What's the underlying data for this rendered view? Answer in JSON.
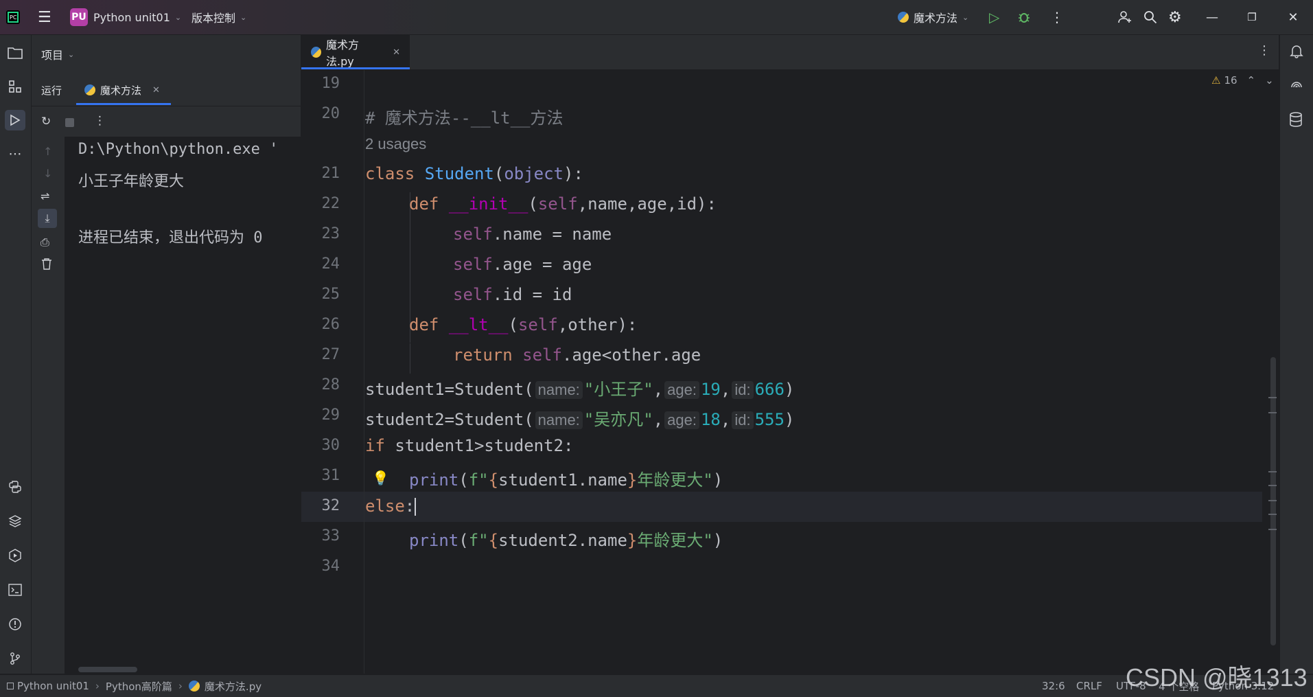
{
  "titlebar": {
    "project_badge": "PU",
    "project_name": "Python unit01",
    "vcs_label": "版本控制",
    "run_config": "魔术方法"
  },
  "left_panel": {
    "project_label": "项目",
    "run_tab_label": "运行",
    "run_config_tab": "魔术方法"
  },
  "run_output": {
    "lines": [
      "D:\\Python\\python.exe '",
      "小王子年龄更大",
      "",
      "进程已结束，退出代码为 0"
    ]
  },
  "editor": {
    "file_tab": "魔术方法.py",
    "warnings_count": "16",
    "usages_hint": "2 usages",
    "line_numbers": [
      "19",
      "20",
      "21",
      "22",
      "23",
      "24",
      "25",
      "26",
      "27",
      "28",
      "29",
      "30",
      "31",
      "32",
      "33",
      "34"
    ],
    "code": {
      "l20": "# 魔术方法--__lt__方法",
      "l21_kw": "class",
      "l21_name": "Student",
      "l21_base": "object",
      "l22_def": "def",
      "l22_fn": "__init__",
      "l22_self": "self",
      "l22_rest": "name,age,id):",
      "l23_self": "self",
      "l23_rest": ".name = name",
      "l24_self": "self",
      "l24_rest": ".age = age",
      "l25_self": "self",
      "l25_rest": ".id = id",
      "l26_def": "def",
      "l26_fn": "__lt__",
      "l26_self": "self",
      "l26_rest": "other):",
      "l27_ret": "return",
      "l27_self": "self",
      "l27_rest": ".age<other.age",
      "l28_pre": "student1=Student(",
      "l28_h1": "name:",
      "l28_s1": "\"小王子\"",
      "l28_h2": "age:",
      "l28_n2": "19",
      "l28_h3": "id:",
      "l28_n3": "666",
      "l29_pre": "student2=Student(",
      "l29_h1": "name:",
      "l29_s1": "\"吴亦凡\"",
      "l29_h2": "age:",
      "l29_n2": "18",
      "l29_h3": "id:",
      "l29_n3": "555",
      "l30_kw": "if",
      "l30_rest": " student1>student2:",
      "l31_print": "print",
      "l31_f": "f\"",
      "l31_expr": "student1.name",
      "l31_tail": "年龄更大\"",
      "l32_kw": "else",
      "l32_colon": ":",
      "l33_print": "print",
      "l33_f": "f\"",
      "l33_expr": "student2.name",
      "l33_tail": "年龄更大\""
    }
  },
  "statusbar": {
    "crumb1": "Python unit01",
    "crumb2": "Python高阶篇",
    "crumb3": "魔术方法.py",
    "position": "32:6",
    "line_ending": "CRLF",
    "encoding": "UTF-8",
    "indent": "4 个空格",
    "interpreter": "Python 3.12"
  },
  "watermark": "CSDN @晓1313",
  "colors": {
    "accent": "#3574f0",
    "keyword": "#cf8e6d",
    "string": "#6aab73",
    "number": "#2aacb8",
    "self": "#94558d",
    "badge": "#b33fa6"
  }
}
